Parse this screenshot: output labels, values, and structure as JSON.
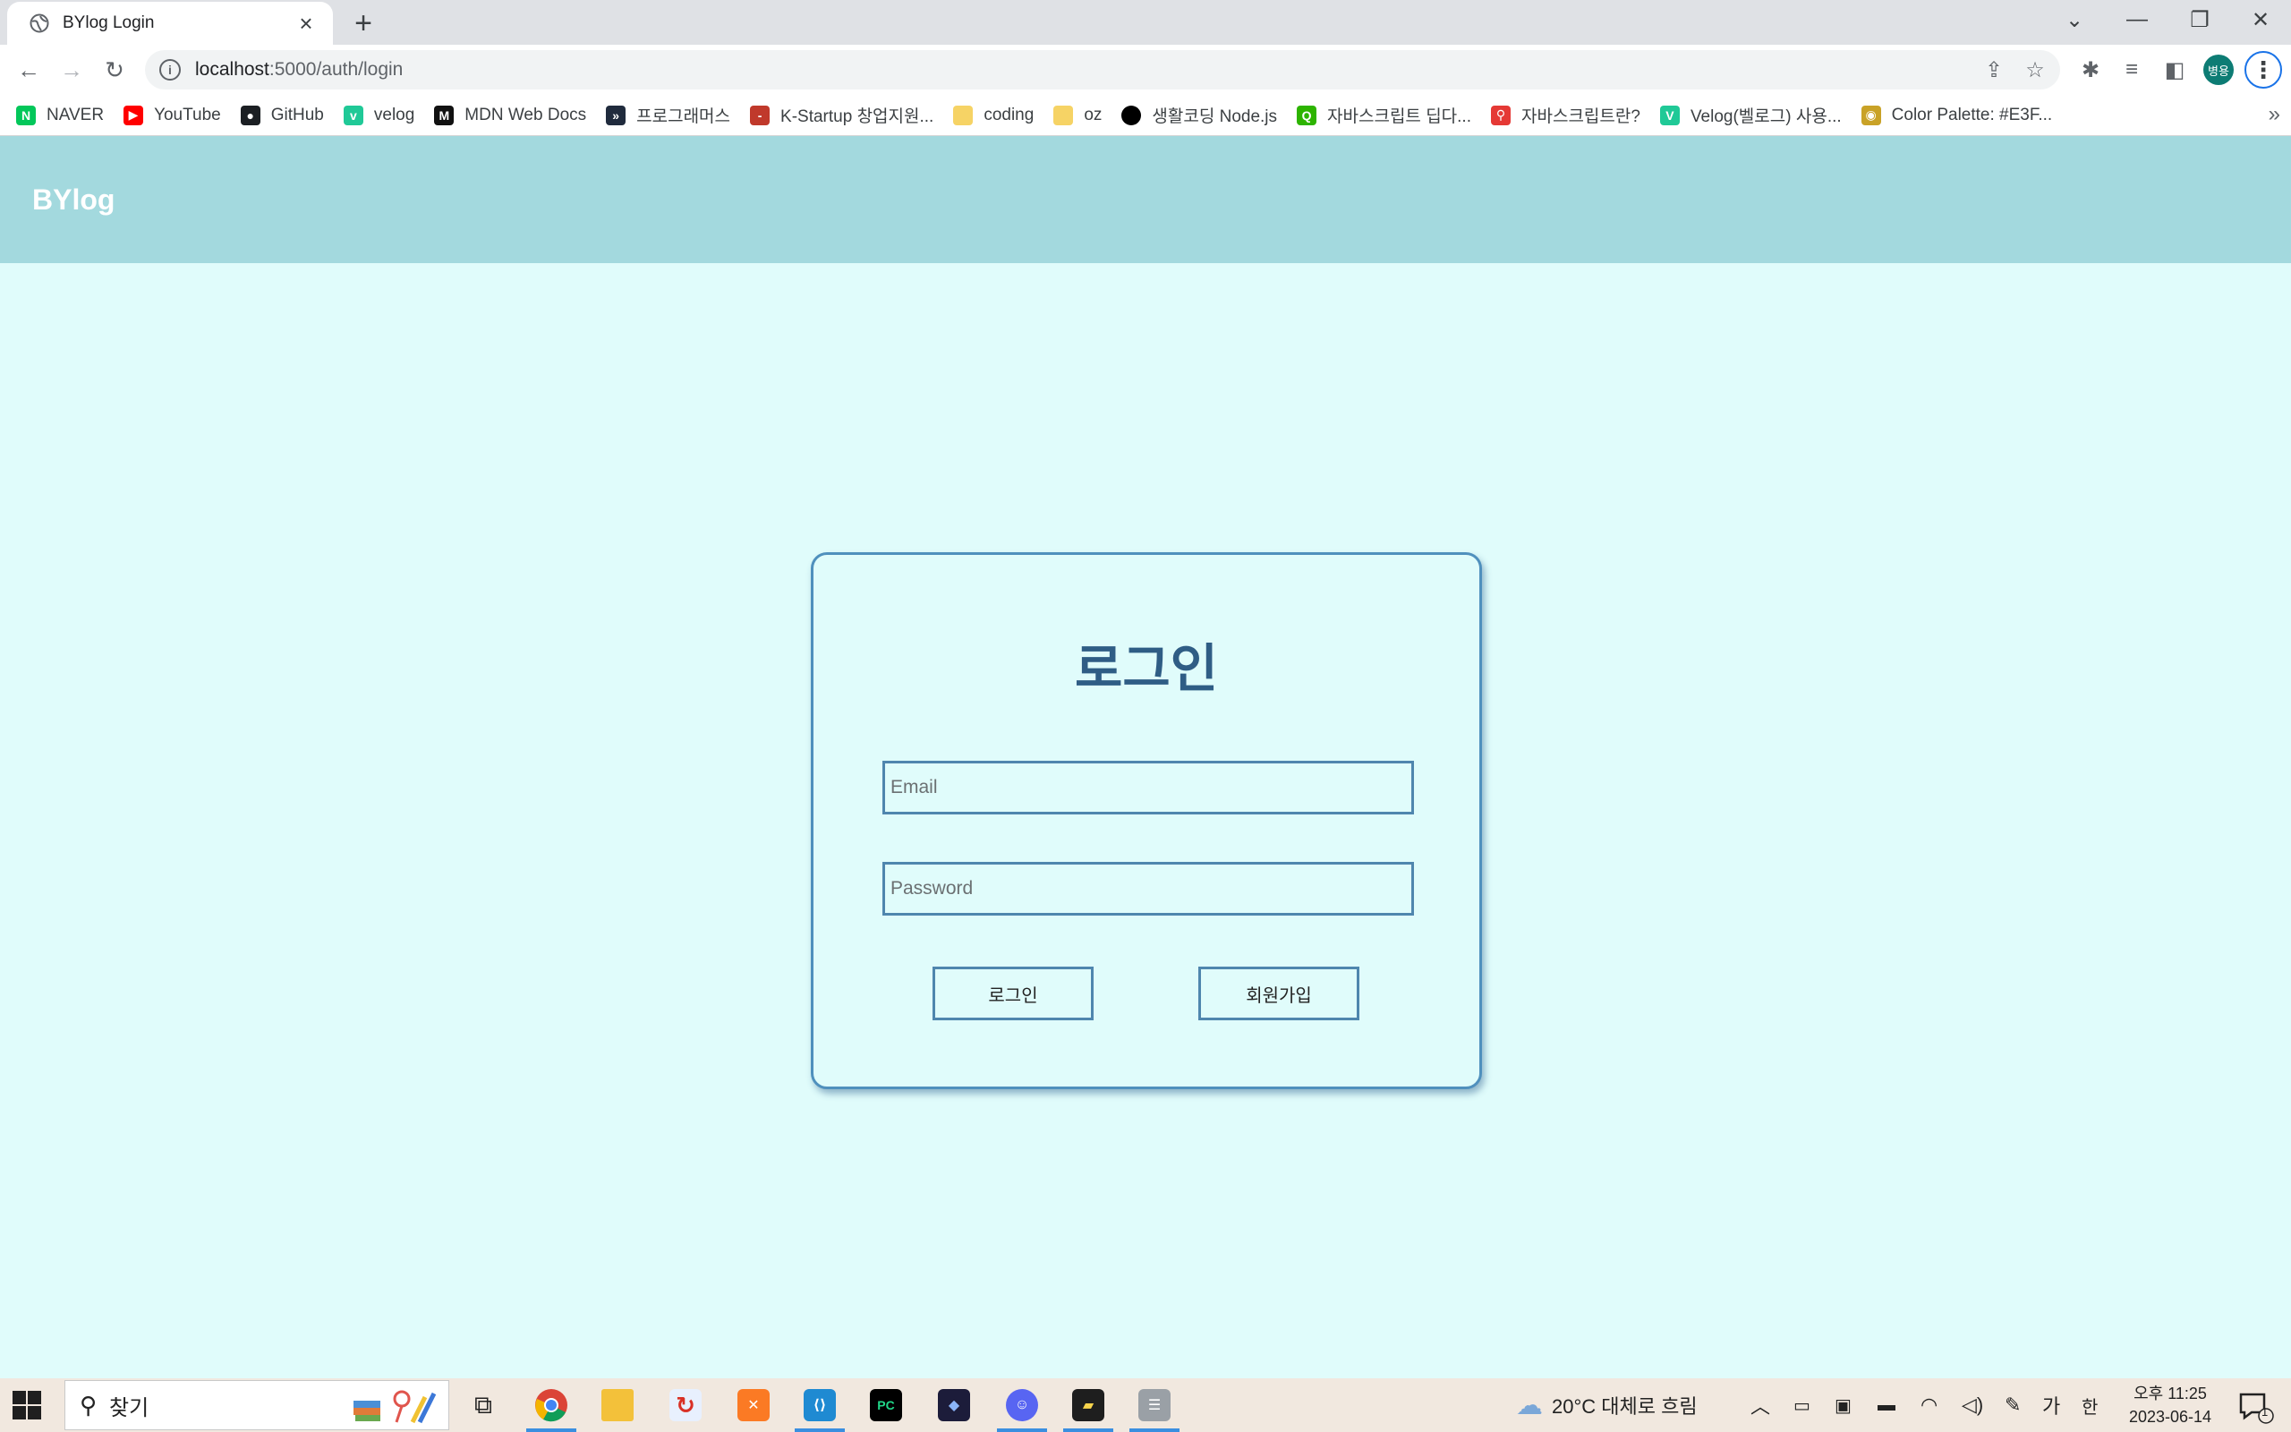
{
  "browser": {
    "tab_title": "BYlog Login",
    "new_tab_symbol": "+",
    "url_host": "localhost",
    "url_path": ":5000/auth/login",
    "profile_initials": "병용",
    "bookmarks": [
      {
        "label": "NAVER",
        "icon": "naver-icon",
        "color": "#03c75a",
        "glyph": "N"
      },
      {
        "label": "YouTube",
        "icon": "youtube-icon",
        "color": "#ff0000",
        "glyph": "▶"
      },
      {
        "label": "GitHub",
        "icon": "github-icon",
        "color": "#1b1f23",
        "glyph": "●"
      },
      {
        "label": "velog",
        "icon": "velog-icon",
        "color": "#20c997",
        "glyph": "v"
      },
      {
        "label": "MDN Web Docs",
        "icon": "mdn-icon",
        "color": "#111111",
        "glyph": "M"
      },
      {
        "label": "프로그래머스",
        "icon": "programmers-icon",
        "color": "#202b3d",
        "glyph": "»"
      },
      {
        "label": "K-Startup 창업지원...",
        "icon": "kstartup-icon",
        "color": "#c0392b",
        "glyph": "-"
      },
      {
        "label": "coding",
        "icon": "folder-icon",
        "color": "#f6d365",
        "glyph": ""
      },
      {
        "label": "oz",
        "icon": "folder-icon",
        "color": "#f6d365",
        "glyph": ""
      },
      {
        "label": "생활코딩 Node.js",
        "icon": "opentutorials-icon",
        "color": "#000000",
        "glyph": ""
      },
      {
        "label": "자바스크립트 딥다...",
        "icon": "search-result-icon",
        "color": "#2db400",
        "glyph": "Q"
      },
      {
        "label": "자바스크립트란?",
        "icon": "tower-icon",
        "color": "#e53935",
        "glyph": "⚲"
      },
      {
        "label": "Velog(벨로그) 사용...",
        "icon": "velog-icon",
        "color": "#20c997",
        "glyph": "V"
      },
      {
        "label": "Color Palette: #E3F...",
        "icon": "palette-icon",
        "color": "#c9a227",
        "glyph": "◉"
      }
    ],
    "bookmarks_overflow": "»"
  },
  "page": {
    "logo": "BYlog",
    "login": {
      "title": "로그인",
      "email_placeholder": "Email",
      "password_placeholder": "Password",
      "login_button": "로그인",
      "signup_button": "회원가입"
    },
    "colors": {
      "header_bg": "#a3d9de",
      "page_bg": "#e0fcfb",
      "card_border": "#4f90bd",
      "title_color": "#2f5d85"
    }
  },
  "taskbar": {
    "search_placeholder": "찾기",
    "weather": "20°C 대체로 흐림",
    "ime_lang": "가",
    "ime_mode": "한",
    "time": "오후 11:25",
    "date": "2023-06-14",
    "notification_count": "1"
  }
}
